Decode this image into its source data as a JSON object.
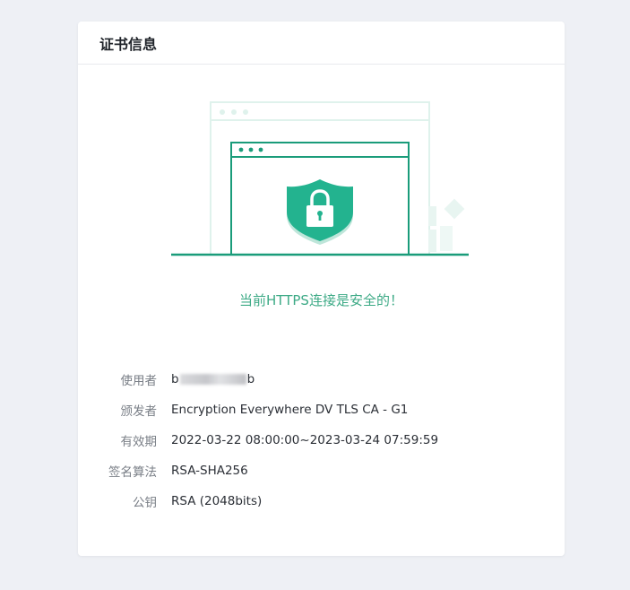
{
  "card": {
    "title": "证书信息"
  },
  "status": {
    "text": "当前HTTPS连接是安全的！",
    "color": "#3daa86"
  },
  "illustration": {
    "icon": "lock-shield-icon",
    "accent": "#1fae8c"
  },
  "certificate": {
    "rows": [
      {
        "label": "使用者",
        "value_prefix": "b",
        "value_suffix": "b",
        "redacted": true
      },
      {
        "label": "颁发者",
        "value": "Encryption Everywhere DV TLS CA - G1"
      },
      {
        "label": "有效期",
        "value": "2022-03-22 08:00:00~2023-03-24 07:59:59"
      },
      {
        "label": "签名算法",
        "value": "RSA-SHA256"
      },
      {
        "label": "公钥",
        "value": "RSA (2048bits)"
      }
    ]
  }
}
